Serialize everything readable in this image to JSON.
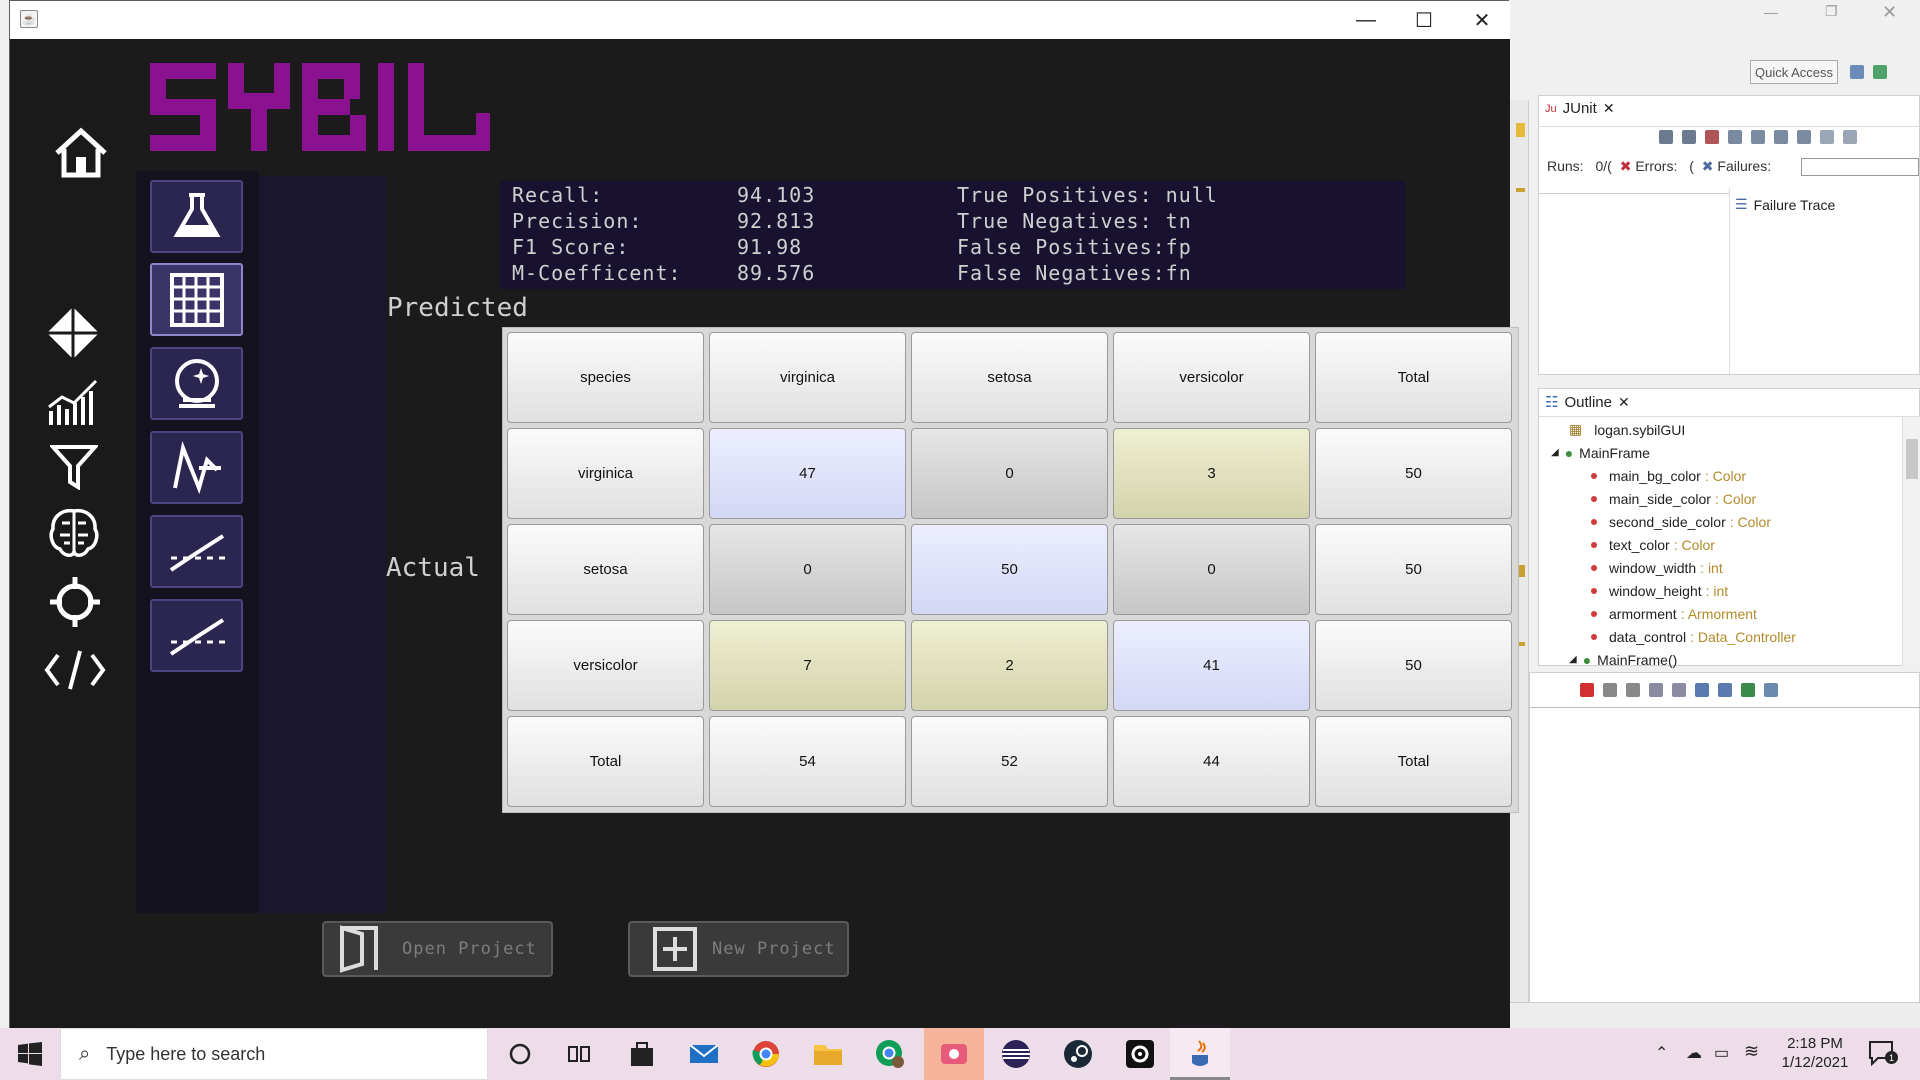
{
  "eclipse": {
    "quick_access": "Quick Access",
    "junit_tab": "JUnit",
    "runs_label": "Runs:",
    "runs_value": "0/(",
    "errors_label": "Errors:",
    "errors_value": "(",
    "failures_label": "Failures:",
    "failure_trace": "Failure Trace",
    "outline_tab": "Outline",
    "outline": {
      "package": "logan.sybilGUI",
      "class": "MainFrame",
      "fields": [
        {
          "name": "main_bg_color",
          "type": ": Color"
        },
        {
          "name": "main_side_color",
          "type": ": Color"
        },
        {
          "name": "second_side_color",
          "type": ": Color"
        },
        {
          "name": "text_color",
          "type": ": Color"
        },
        {
          "name": "window_width",
          "type": ": int"
        },
        {
          "name": "window_height",
          "type": ": int"
        },
        {
          "name": "armorment",
          "type": ": Armorment"
        },
        {
          "name": "data_control",
          "type": ": Data_Controller"
        }
      ],
      "constructor": "MainFrame()"
    }
  },
  "app": {
    "logo_text": "SYBIL",
    "stats": [
      {
        "label": "Recall:",
        "value": "94.103",
        "label2": "True Positives:",
        "value2": "null"
      },
      {
        "label": "Precision:",
        "value": "92.813",
        "label2": "True Negatives:",
        "value2": "tn"
      },
      {
        "label": "F1 Score:",
        "value": "91.98",
        "label2": "False Positives:",
        "value2": "fp"
      },
      {
        "label": "M-Coefficent:",
        "value": "89.576",
        "label2": "False Negatives:",
        "value2": "fn"
      }
    ],
    "predicted_label": "Predicted",
    "actual_label": "Actual",
    "matrix": {
      "header": [
        "species",
        "virginica",
        "setosa",
        "versicolor",
        "Total"
      ],
      "rows": [
        [
          "virginica",
          "47",
          "0",
          "3",
          "50"
        ],
        [
          "setosa",
          "0",
          "50",
          "0",
          "50"
        ],
        [
          "versicolor",
          "7",
          "2",
          "41",
          "50"
        ],
        [
          "Total",
          "54",
          "52",
          "44",
          "Total"
        ]
      ]
    },
    "open_project": "Open Project",
    "new_project": "New Project"
  },
  "taskbar": {
    "search_placeholder": "Type here to search",
    "time": "2:18 PM",
    "date": "1/12/2021",
    "notification_count": "1"
  },
  "colors": {
    "logo": "#8a1290",
    "sidebar": "#1a1a1a",
    "tool_button": "#2b2650",
    "diag_cell": "#dcdff8",
    "error_cell": "#e0e0c0"
  }
}
